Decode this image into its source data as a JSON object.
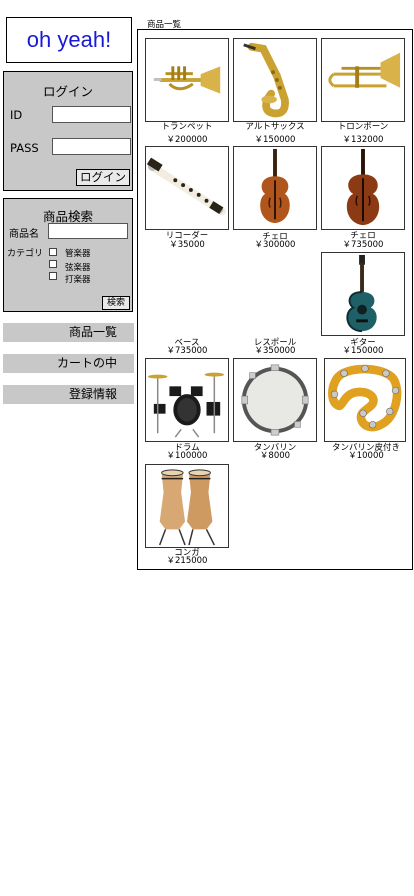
{
  "logo": {
    "text": "oh yeah!"
  },
  "login": {
    "title": "ログイン",
    "id_label": "ID",
    "pass_label": "PASS",
    "id_value": "",
    "pass_value": "",
    "button": "ログイン"
  },
  "search": {
    "title": "商品検索",
    "name_label": "商品名",
    "name_value": "",
    "category_label": "カテゴリ",
    "categories": [
      "管楽器",
      "弦楽器",
      "打楽器"
    ],
    "button": "検索"
  },
  "nav": {
    "list": "商品一覧",
    "cart": "カートの中",
    "registration": "登録情報"
  },
  "catalog": {
    "title": "商品一覧",
    "products": [
      {
        "name": "トランペット",
        "price": "￥200000",
        "image": "trumpet-image"
      },
      {
        "name": "アルトサックス",
        "price": "￥150000",
        "image": "saxophone-image"
      },
      {
        "name": "トロンボーン",
        "price": "￥132000",
        "image": "trombone-image"
      },
      {
        "name": "リコーダー",
        "price": "￥35000",
        "image": "recorder-image"
      },
      {
        "name": "チェロ",
        "price": "￥300000",
        "image": "cello-image"
      },
      {
        "name": "チェロ",
        "price": "￥735000",
        "image": "cello-image"
      },
      {
        "name": "ベース",
        "price": "￥735000",
        "image": ""
      },
      {
        "name": "レスポール",
        "price": "￥350000",
        "image": ""
      },
      {
        "name": "ギター",
        "price": "￥150000",
        "image": "acoustic-guitar-image"
      },
      {
        "name": "ドラム",
        "price": "￥100000",
        "image": "drum-kit-image"
      },
      {
        "name": "タンバリン",
        "price": "￥8000",
        "image": "tambourine-image"
      },
      {
        "name": "タンバリン皮付き",
        "price": "￥10000",
        "image": "tambourine-ring-image"
      },
      {
        "name": "コンガ",
        "price": "￥215000",
        "image": "conga-image"
      }
    ]
  }
}
